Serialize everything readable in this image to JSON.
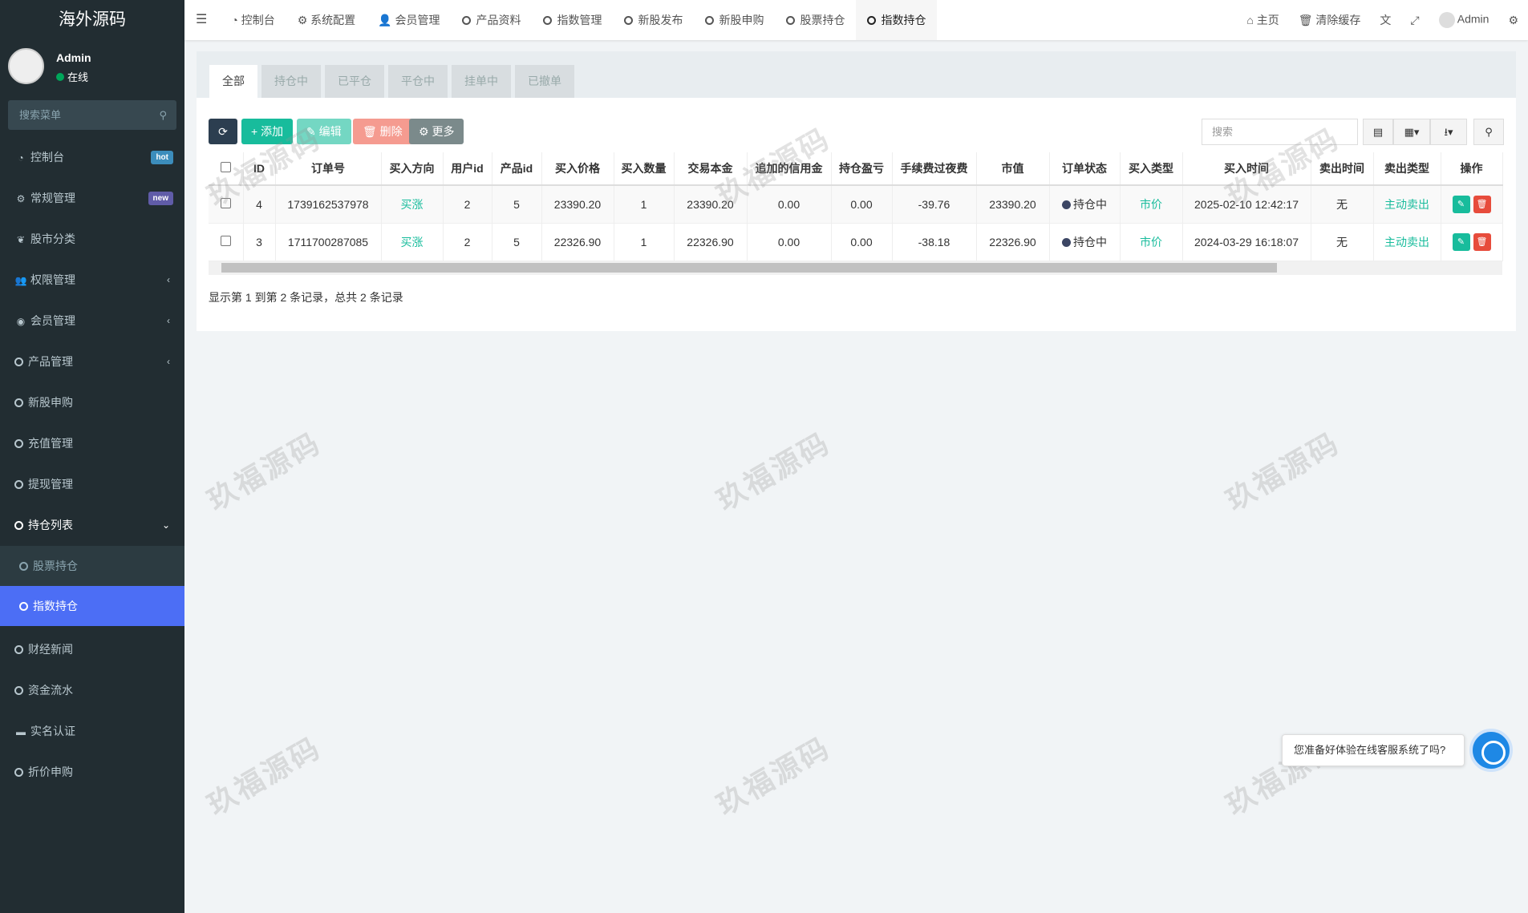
{
  "brand": "海外源码",
  "user": {
    "name": "Admin",
    "status": "在线"
  },
  "sidebar": {
    "search_placeholder": "搜索菜单",
    "items": [
      {
        "label": "控制台",
        "badge": "hot",
        "badge_color": "#3c8dbc"
      },
      {
        "label": "常规管理",
        "badge": "new",
        "badge_color": "#605ca8"
      },
      {
        "label": "股市分类"
      },
      {
        "label": "权限管理"
      },
      {
        "label": "会员管理"
      },
      {
        "label": "产品管理"
      },
      {
        "label": "新股申购"
      },
      {
        "label": "充值管理"
      },
      {
        "label": "提现管理"
      },
      {
        "label": "持仓列表"
      }
    ],
    "sub_items": [
      {
        "label": "股票持仓"
      },
      {
        "label": "指数持仓"
      }
    ],
    "items_after": [
      {
        "label": "财经新闻"
      },
      {
        "label": "资金流水"
      },
      {
        "label": "实名认证"
      },
      {
        "label": "折价申购"
      }
    ]
  },
  "header": {
    "tabs": [
      "控制台",
      "系统配置",
      "会员管理",
      "产品资料",
      "指数管理",
      "新股发布",
      "新股申购",
      "股票持仓",
      "指数持仓"
    ],
    "right": {
      "home": "主页",
      "clear_cache": "清除缓存",
      "admin": "Admin"
    }
  },
  "filter_tabs": [
    "全部",
    "持仓中",
    "已平仓",
    "平仓中",
    "挂单中",
    "已撤单"
  ],
  "toolbar": {
    "add": "添加",
    "edit": "编辑",
    "delete": "删除",
    "more": "更多",
    "search_placeholder": "搜索"
  },
  "table": {
    "columns": [
      "ID",
      "订单号",
      "买入方向",
      "用户id",
      "产品id",
      "买入价格",
      "买入数量",
      "交易本金",
      "追加的信用金",
      "持仓盈亏",
      "手续费过夜费",
      "市值",
      "订单状态",
      "买入类型",
      "买入时间",
      "卖出时间",
      "卖出类型",
      "操作"
    ],
    "rows": [
      {
        "id": "4",
        "order": "1739162537978",
        "dir": "买涨",
        "uid": "2",
        "pid": "5",
        "price": "23390.20",
        "qty": "1",
        "principal": "23390.20",
        "credit": "0.00",
        "pnl": "0.00",
        "fee": "-39.76",
        "value": "23390.20",
        "status": "持仓中",
        "type": "市价",
        "time": "2025-02-10 12:42:17",
        "sell_time": "无",
        "sell_type": "主动卖出"
      },
      {
        "id": "3",
        "order": "1711700287085",
        "dir": "买涨",
        "uid": "2",
        "pid": "5",
        "price": "22326.90",
        "qty": "1",
        "principal": "22326.90",
        "credit": "0.00",
        "pnl": "0.00",
        "fee": "-38.18",
        "value": "22326.90",
        "status": "持仓中",
        "type": "市价",
        "time": "2024-03-29 16:18:07",
        "sell_time": "无",
        "sell_type": "主动卖出"
      }
    ]
  },
  "pagination_info": "显示第 1 到第 2 条记录，总共 2 条记录",
  "watermark": "玖福源码",
  "chat_prompt": "您准备好体验在线客服系统了吗?"
}
